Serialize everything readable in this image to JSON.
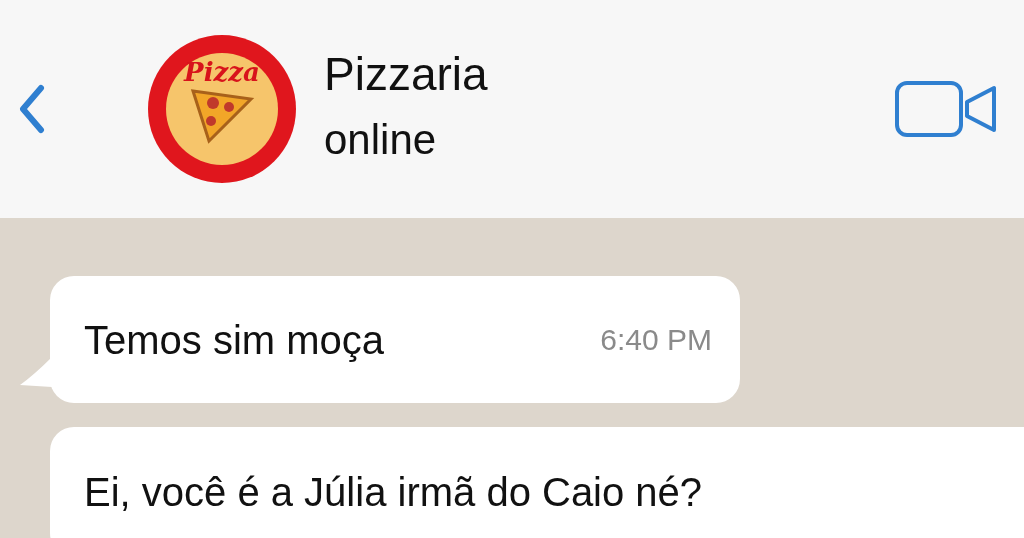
{
  "header": {
    "contact_name": "Pizzaria",
    "status": "online",
    "avatar_text": "Pizza"
  },
  "messages": [
    {
      "text": "Temos sim moça",
      "time": "6:40 PM",
      "tail": true
    },
    {
      "text": "Ei, você é a Júlia irmã do Caio né?",
      "tail": false
    }
  ]
}
